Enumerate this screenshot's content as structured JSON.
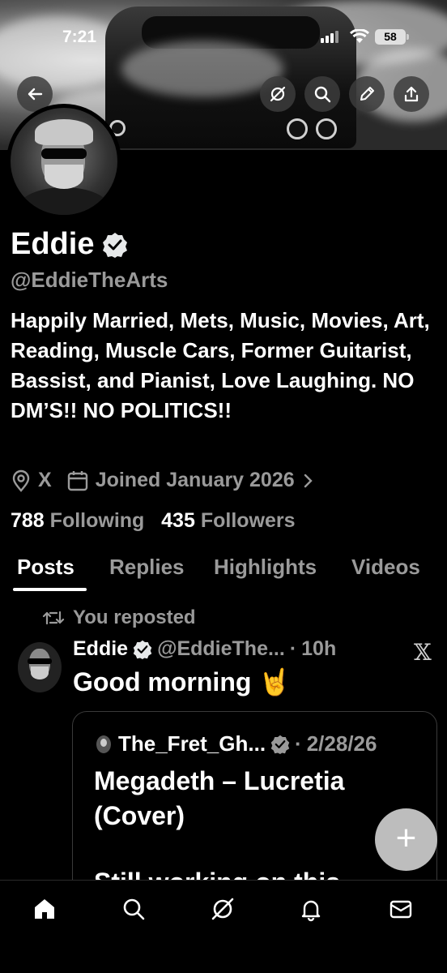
{
  "status_bar": {
    "time": "7:21",
    "battery": "58"
  },
  "profile": {
    "name": "Eddie",
    "handle": "@EddieTheArts",
    "bio": "Happily Married, Mets, Music, Movies, Art, Reading, Muscle Cars, Former Guitarist, Bassist, and Pianist, Love Laughing. NO DM’S!! NO POLITICS!!",
    "location": "X",
    "joined": "Joined January 2026",
    "following_count": "788",
    "following_label": "Following",
    "followers_count": "435",
    "followers_label": "Followers"
  },
  "tabs": [
    {
      "label": "Posts",
      "active": true
    },
    {
      "label": "Replies",
      "active": false
    },
    {
      "label": "Highlights",
      "active": false
    },
    {
      "label": "Videos",
      "active": false
    }
  ],
  "post": {
    "repost_label": "You reposted",
    "author_name": "Eddie",
    "author_handle": "@EddieThe...",
    "separator": "·",
    "time": "10h",
    "text": "Good morning 🤘",
    "quote": {
      "author_name": "The_Fret_Gh...",
      "date": "2/28/26",
      "title_line1": "Megadeth – Lucretia",
      "title_line2": "(Cover)",
      "body_partial": "Still working on this"
    }
  },
  "fab_label": "+",
  "colors": {
    "background": "#000000",
    "text": "#e7e9ea",
    "muted": "#9a9a9a",
    "fab": "#bdbdbd"
  }
}
